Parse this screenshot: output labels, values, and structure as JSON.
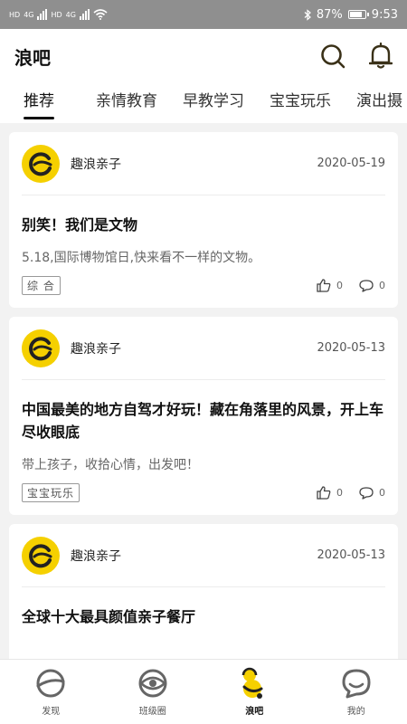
{
  "status_bar": {
    "left_badges": [
      "HD",
      "4G",
      "HD",
      "4G"
    ],
    "battery": "87%",
    "time": "9:53"
  },
  "header": {
    "title": "浪吧",
    "icons": [
      "search-icon",
      "bell-icon"
    ]
  },
  "tabs": [
    {
      "label": "推荐",
      "active": true
    },
    {
      "label": "亲情教育"
    },
    {
      "label": "早教学习"
    },
    {
      "label": "宝宝玩乐"
    },
    {
      "label": "演出摄"
    }
  ],
  "posts": [
    {
      "author": "趣浪亲子",
      "date": "2020-05-19",
      "title": "别笑！我们是文物",
      "desc": "5.18,国际博物馆日,快来看不一样的文物。",
      "tag": "综 合",
      "likes": "0",
      "comments": "0"
    },
    {
      "author": "趣浪亲子",
      "date": "2020-05-13",
      "title": "中国最美的地方自驾才好玩！藏在角落里的风景，开上车尽收眼底",
      "desc": "带上孩子，收拾心情，出发吧！",
      "tag": "宝宝玩乐",
      "likes": "0",
      "comments": "0"
    },
    {
      "author": "趣浪亲子",
      "date": "2020-05-13",
      "title": "全球十大最具颜值亲子餐厅"
    }
  ],
  "bottom_nav": [
    {
      "label": "发现",
      "icon": "planet-icon"
    },
    {
      "label": "班级圈",
      "icon": "circle-eye-icon"
    },
    {
      "label": "浪吧",
      "icon": "langba-logo-icon",
      "active": true
    },
    {
      "label": "我的",
      "icon": "profile-icon"
    }
  ],
  "colors": {
    "accent_yellow": "#f5d000",
    "status_bar": "#8f8f8f",
    "icon_dark": "#3a3118"
  }
}
